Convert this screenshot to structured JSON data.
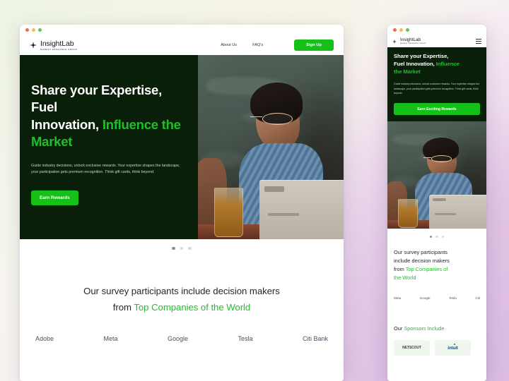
{
  "background": {
    "gradient_from": "#f3f6ea",
    "gradient_to": "#e3cde9"
  },
  "theme": {
    "accent_green": "#15c017",
    "heading_green": "#1fbf2a",
    "hero_dark": "#0a1f0a"
  },
  "desktop": {
    "brand": {
      "name": "InsightLab",
      "tagline": "MARKET RESEARCH GROUP",
      "icon": "four-point-star-icon"
    },
    "nav": {
      "links": [
        {
          "label": "About Us"
        },
        {
          "label": "FAQ's"
        }
      ],
      "signup_label": "Sign Up"
    },
    "hero": {
      "heading_line1": "Share your Expertise, Fuel",
      "heading_line2_plain": "Innovation, ",
      "heading_line2_accent": "Influence the",
      "heading_line3_accent": "Market",
      "body": "Guide industry decisions, unlock exclusive rewards. Your expertise shapes the landscape, your participation gets premium recognition. Think gift cards, think beyond.",
      "cta_label": "Earn Rewards",
      "image_alt": "Smiling person with glasses using a laptop at a table"
    },
    "carousel": {
      "total": 3,
      "active_index": 0
    },
    "companies": {
      "heading_line1": "Our survey participants include decision makers",
      "heading_line2_plain": "from ",
      "heading_line2_accent": "Top Companies of the World",
      "brands": [
        {
          "label": "Adobe"
        },
        {
          "label": "Meta"
        },
        {
          "label": "Google"
        },
        {
          "label": "Tesla"
        },
        {
          "label": "Citi Bank"
        }
      ]
    }
  },
  "mobile": {
    "brand": {
      "name": "InsightLab",
      "tagline": "MARKET RESEARCH GROUP",
      "icon": "four-point-star-icon",
      "menu_icon": "hamburger-menu-icon"
    },
    "hero": {
      "heading_line1": "Share your Expertise,",
      "heading_line2_plain": "Fuel Innovation, ",
      "heading_line2_accent": "Influence",
      "heading_line3_accent": "the Market",
      "body": "Guide industry decisions, unlock exclusive rewards. Your expertise shapes the landscape, your participation gets premium recognition. Think gift cards, think beyond.",
      "cta_label": "Earn Exciting Rewards"
    },
    "carousel": {
      "total": 3,
      "active_index": 0
    },
    "companies": {
      "heading_line1": "Our survey participants",
      "heading_line2": "include decision makers",
      "heading_line3_plain": "from ",
      "heading_line3_accent": "Top Companies of",
      "heading_line4_accent": "the World",
      "brands": [
        {
          "label": "Meta"
        },
        {
          "label": "Google"
        },
        {
          "label": "Tesla"
        },
        {
          "label": "Citi"
        }
      ]
    },
    "sponsors": {
      "heading_plain": "Our ",
      "heading_accent": "Sponsors Include",
      "cards": [
        {
          "label": "NETSCOUT"
        },
        {
          "label": "intuit"
        }
      ]
    }
  }
}
